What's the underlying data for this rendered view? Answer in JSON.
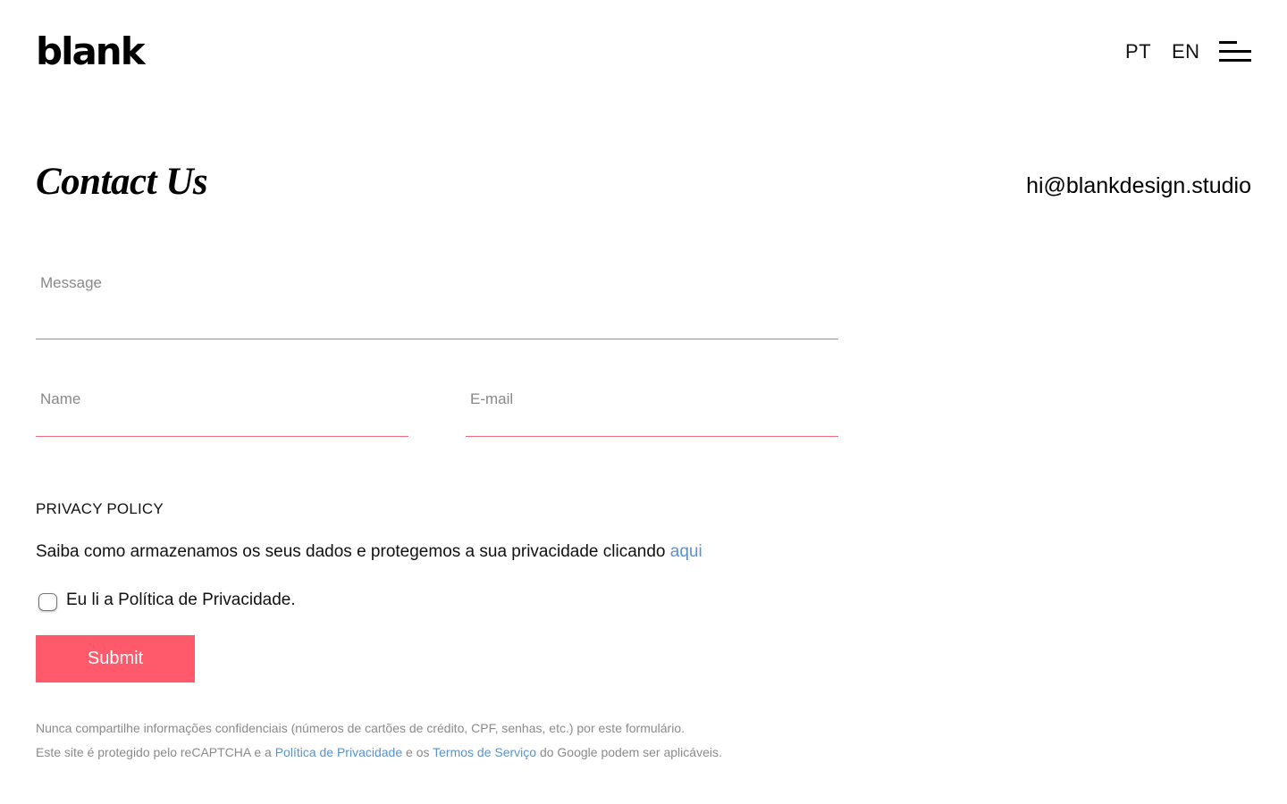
{
  "header": {
    "logo": "blank",
    "languages": [
      "PT",
      "EN"
    ],
    "menu_icon": "hamburger-menu-icon"
  },
  "contact": {
    "title": "Contact Us",
    "email": "hi@blankdesign.studio"
  },
  "form": {
    "message_placeholder": "Message",
    "name_placeholder": "Name",
    "email_placeholder": "E-mail",
    "accent_color": "#f06b7a"
  },
  "privacy": {
    "heading": "PRIVACY POLICY",
    "text": "Saiba como armazenamos os seus dados e protegemos a sua privacidade clicando",
    "link": "aqui",
    "checkbox_label": "Eu li a Política de Privacidade."
  },
  "submit": {
    "label": "Submit",
    "color": "#fe5a6b"
  },
  "notes": {
    "line1": "Nunca compartilhe informações confidenciais (números de cartões de crédito, CPF, senhas, etc.) por este formulário.",
    "line2_prefix": "Este site é protegido pelo reCAPTCHA e a",
    "line2_link1": "Política de Privacidade",
    "line2_mid": "e os",
    "line2_link2": "Termos de Serviço",
    "line2_suffix": "do Google podem ser aplicáveis."
  },
  "colors": {
    "link": "#5b92cc",
    "muted_text": "#8a8a8a"
  }
}
